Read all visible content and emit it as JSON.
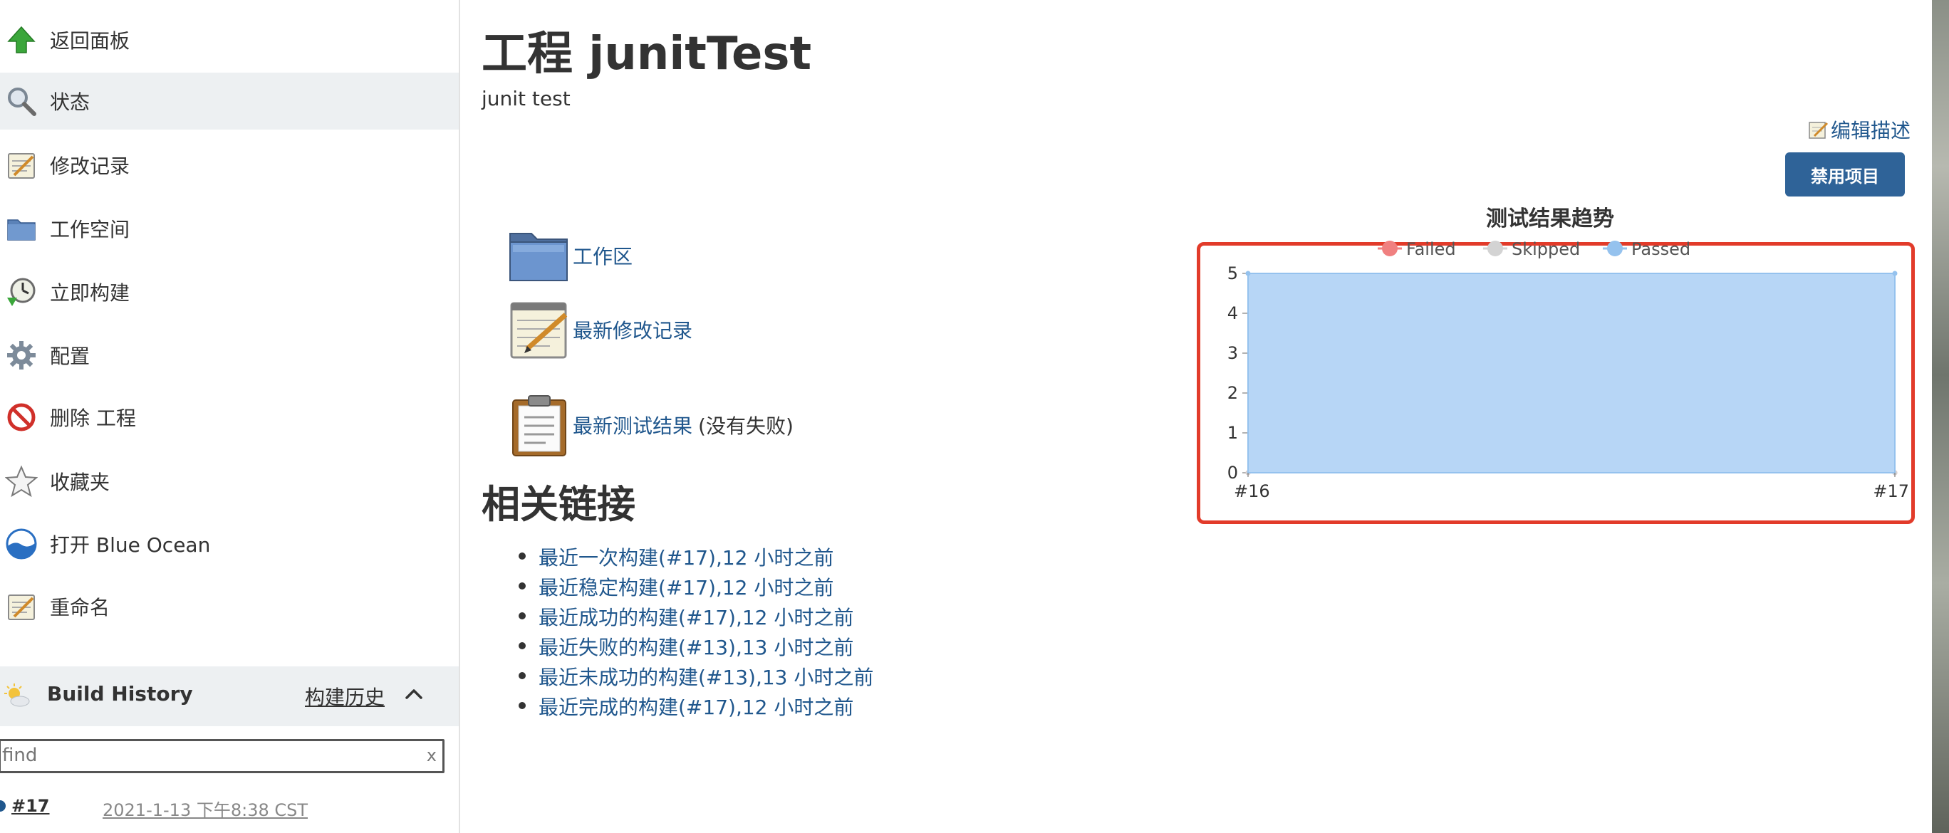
{
  "sidebar": {
    "items": [
      {
        "label": "返回面板",
        "icon": "up-arrow-icon"
      },
      {
        "label": "状态",
        "icon": "magnifier-icon",
        "active": true
      },
      {
        "label": "修改记录",
        "icon": "notepad-icon"
      },
      {
        "label": "工作空间",
        "icon": "folder-icon"
      },
      {
        "label": "立即构建",
        "icon": "clock-build-icon"
      },
      {
        "label": "配置",
        "icon": "gear-icon"
      },
      {
        "label": "删除 工程",
        "icon": "no-entry-icon"
      },
      {
        "label": "收藏夹",
        "icon": "star-icon"
      },
      {
        "label": "打开 Blue Ocean",
        "icon": "blue-ocean-icon"
      },
      {
        "label": "重命名",
        "icon": "notepad-icon"
      }
    ],
    "build_history": {
      "title": "Build History",
      "link": "构建历史",
      "search_placeholder": "find",
      "clear": "x",
      "builds": [
        {
          "number": "#17",
          "date": "2021-1-13 下午8:38 CST"
        }
      ]
    }
  },
  "main": {
    "title": "工程 junitTest",
    "description": "junit test",
    "edit_description": "编辑描述",
    "disable_button": "禁用项目",
    "links": [
      {
        "label": "工作区",
        "icon": "folder-icon"
      },
      {
        "label": "最新修改记录",
        "icon": "notepad-icon"
      },
      {
        "label": "最新测试结果",
        "note": "(没有失败)",
        "icon": "clipboard-icon"
      }
    ],
    "related_title": "相关链接",
    "related_links": [
      "最近一次构建(#17),12 小时之前",
      "最近稳定构建(#17),12 小时之前",
      "最近成功的构建(#17),12 小时之前",
      "最近失败的构建(#13),13 小时之前",
      "最近未成功的构建(#13),13 小时之前",
      "最近完成的构建(#17),12 小时之前"
    ]
  },
  "colors": {
    "link": "#20578d",
    "button": "#2f6398",
    "highlight_border": "#e23b2a",
    "passed_fill": "#b7d6f6",
    "passed_line": "#95c2ee",
    "failed": "#f08080",
    "skipped": "#d3d3d3"
  },
  "chart_data": {
    "type": "area",
    "title": "测试结果趋势",
    "categories": [
      "#16",
      "#17"
    ],
    "series": [
      {
        "name": "Failed",
        "values": [
          0,
          0
        ]
      },
      {
        "name": "Skipped",
        "values": [
          0,
          0
        ]
      },
      {
        "name": "Passed",
        "values": [
          5,
          5
        ]
      }
    ],
    "ylim": [
      0,
      5
    ],
    "yticks": [
      "0",
      "1",
      "2",
      "3",
      "4",
      "5"
    ],
    "legend": "top",
    "grid": true
  }
}
